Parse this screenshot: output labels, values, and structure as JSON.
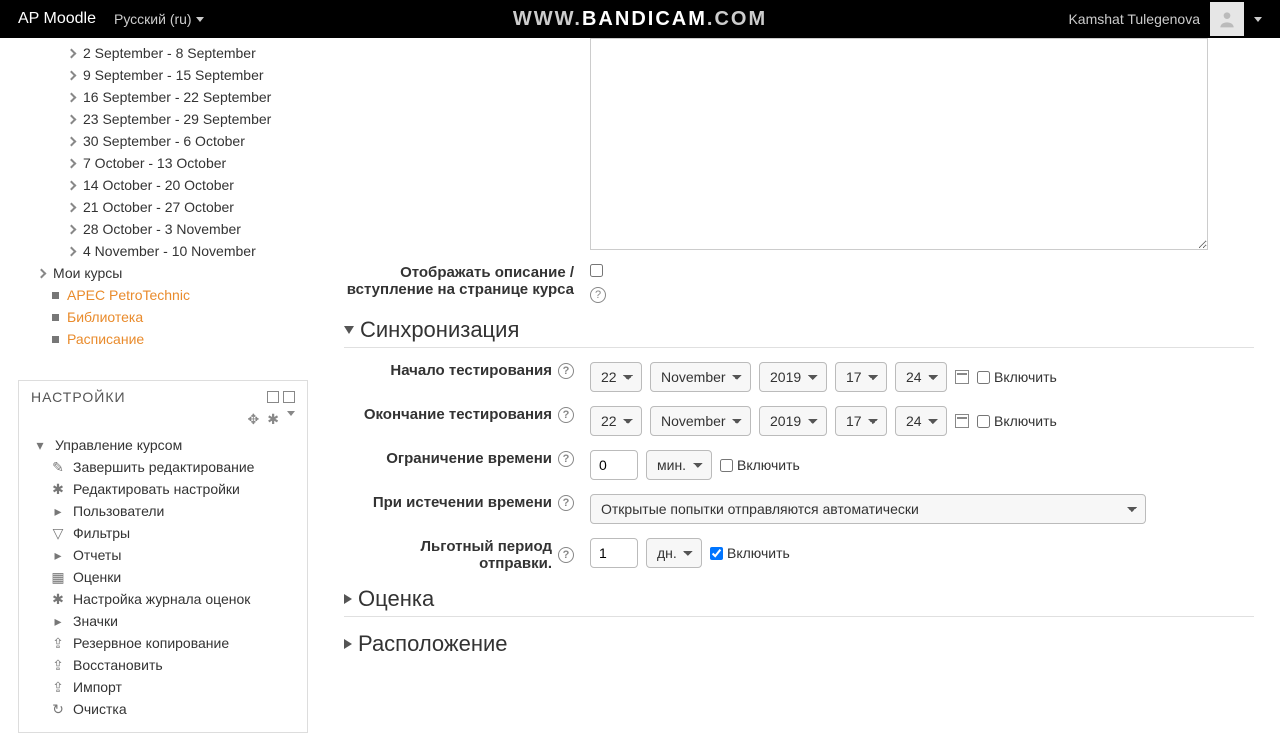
{
  "header": {
    "brand": "AP Moodle",
    "lang": "Русский (ru)",
    "watermark_prefix": "WWW.",
    "watermark_main": "BANDICAM",
    "watermark_suffix": ".COM",
    "user": "Kamshat Tulegenova"
  },
  "nav_weeks": [
    "2 September - 8 September",
    "9 September - 15 September",
    "16 September - 22 September",
    "23 September - 29 September",
    "30 September - 6 October",
    "7 October - 13 October",
    "14 October - 20 October",
    "21 October - 27 October",
    "28 October - 3 November",
    "4 November - 10 November"
  ],
  "nav_my_courses": "Мои курсы",
  "nav_links": [
    "APEC PetroTechnic",
    "Библиотека",
    "Расписание"
  ],
  "settings_block": {
    "title": "НАСТРОЙКИ",
    "root": "Управление курсом",
    "items": [
      {
        "icon": "pencil",
        "label": "Завершить редактирование",
        "active": true
      },
      {
        "icon": "gear",
        "label": "Редактировать настройки",
        "active": true
      },
      {
        "icon": "caret",
        "label": "Пользователи",
        "active": false
      },
      {
        "icon": "funnel",
        "label": "Фильтры",
        "active": true
      },
      {
        "icon": "caret",
        "label": "Отчеты",
        "active": false
      },
      {
        "icon": "grid",
        "label": "Оценки",
        "active": true
      },
      {
        "icon": "gear",
        "label": "Настройка журнала оценок",
        "active": true
      },
      {
        "icon": "caret",
        "label": "Значки",
        "active": false
      },
      {
        "icon": "box-up",
        "label": "Резервное копирование",
        "active": true
      },
      {
        "icon": "box-up",
        "label": "Восстановить",
        "active": true
      },
      {
        "icon": "box-up",
        "label": "Импорт",
        "active": true
      },
      {
        "icon": "recycle",
        "label": "Очистка",
        "active": true
      }
    ]
  },
  "form": {
    "show_desc_label": "Отображать описание / вступление на странице курса",
    "sync_header": "Синхронизация",
    "start_label": "Начало тестирования",
    "end_label": "Окончание тестирования",
    "limit_label": "Ограничение времени",
    "expire_label": "При истечении времени",
    "grace_label": "Льготный период отправки.",
    "grade_header": "Оценка",
    "layout_header": "Расположение",
    "enable": "Включить",
    "date1": {
      "day": "22",
      "month": "November",
      "year": "2019",
      "hour": "17",
      "min": "24"
    },
    "date2": {
      "day": "22",
      "month": "November",
      "year": "2019",
      "hour": "17",
      "min": "24"
    },
    "limit_val": "0",
    "limit_unit": "мин.",
    "expire_val": "Открытые попытки отправляются автоматически",
    "grace_val": "1",
    "grace_unit": "дн."
  }
}
